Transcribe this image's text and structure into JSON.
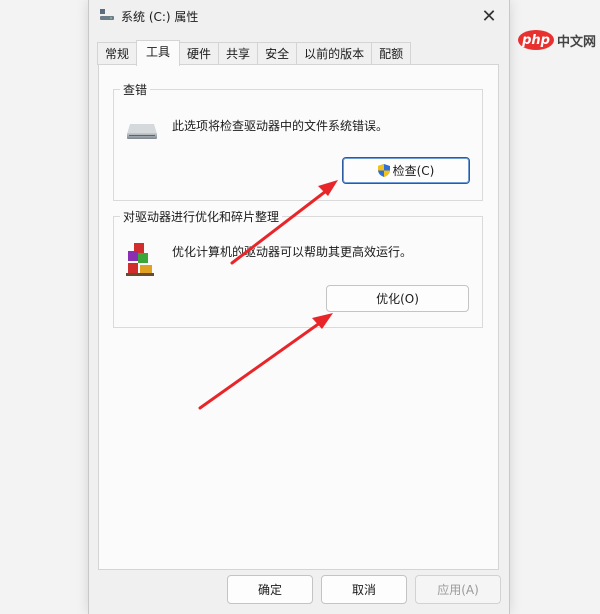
{
  "window": {
    "title": "系统 (C:) 属性",
    "close": "✕"
  },
  "tabs": [
    {
      "label": "常规",
      "active": false
    },
    {
      "label": "工具",
      "active": true
    },
    {
      "label": "硬件",
      "active": false
    },
    {
      "label": "共享",
      "active": false
    },
    {
      "label": "安全",
      "active": false
    },
    {
      "label": "以前的版本",
      "active": false
    },
    {
      "label": "配额",
      "active": false
    }
  ],
  "check_group": {
    "title": "查错",
    "description": "此选项将检查驱动器中的文件系统错误。",
    "button_label": "检查(C)",
    "icon": "drive-icon"
  },
  "optimize_group": {
    "title": "对驱动器进行优化和碎片整理",
    "description": "优化计算机的驱动器可以帮助其更高效运行。",
    "button_label": "优化(O)",
    "icon": "defrag-icon"
  },
  "footer": {
    "ok_label": "确定",
    "cancel_label": "取消",
    "apply_label": "应用(A)"
  },
  "watermark": {
    "php": "php",
    "site": "中文网"
  },
  "colors": {
    "accent": "#2a5b9e",
    "arrow": "#e8262a"
  }
}
